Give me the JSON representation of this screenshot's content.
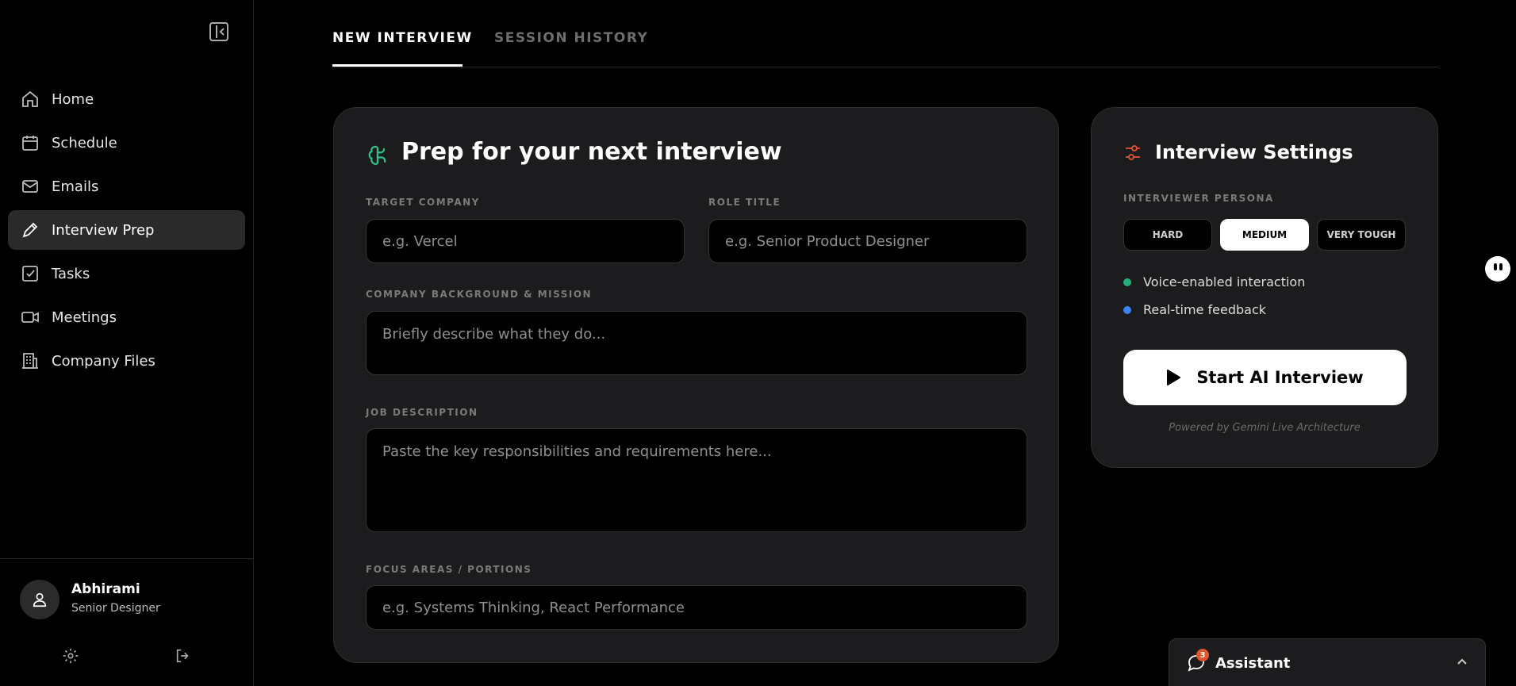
{
  "sidebar": {
    "items": [
      {
        "label": "Home",
        "icon": "home-icon"
      },
      {
        "label": "Schedule",
        "icon": "calendar-icon"
      },
      {
        "label": "Emails",
        "icon": "mail-icon"
      },
      {
        "label": "Interview Prep",
        "icon": "pen-icon",
        "active": true
      },
      {
        "label": "Tasks",
        "icon": "checkbox-icon"
      },
      {
        "label": "Meetings",
        "icon": "video-icon"
      },
      {
        "label": "Company Files",
        "icon": "building-icon"
      }
    ],
    "user": {
      "name": "Abhirami",
      "role": "Senior Designer"
    }
  },
  "tabs": [
    {
      "label": "NEW INTERVIEW",
      "active": true
    },
    {
      "label": "SESSION HISTORY",
      "active": false
    }
  ],
  "main": {
    "title": "Prep for your next interview",
    "fields": {
      "company": {
        "label": "TARGET COMPANY",
        "placeholder": "e.g. Vercel"
      },
      "role": {
        "label": "ROLE TITLE",
        "placeholder": "e.g. Senior Product Designer"
      },
      "background": {
        "label": "COMPANY BACKGROUND & MISSION",
        "placeholder": "Briefly describe what they do..."
      },
      "job": {
        "label": "JOB DESCRIPTION",
        "placeholder": "Paste the key responsibilities and requirements here..."
      },
      "focus": {
        "label": "FOCUS AREAS / PORTIONS",
        "placeholder": "e.g. Systems Thinking, React Performance"
      }
    }
  },
  "settings": {
    "title": "Interview Settings",
    "persona_label": "INTERVIEWER PERSONA",
    "personas": [
      {
        "label": "HARD",
        "selected": false
      },
      {
        "label": "MEDIUM",
        "selected": true
      },
      {
        "label": "VERY TOUGH",
        "selected": false
      }
    ],
    "features": [
      {
        "label": "Voice-enabled interaction",
        "color": "#22b07d"
      },
      {
        "label": "Real-time feedback",
        "color": "#3b82f6"
      }
    ],
    "start_label": "Start AI Interview",
    "powered_by": "Powered by Gemini Live Architecture"
  },
  "assistant": {
    "label": "Assistant",
    "badge": "3"
  },
  "colors": {
    "accent_green": "#2fbf8f",
    "accent_orange": "#e0572f",
    "card_bg": "#1c1c1e"
  }
}
